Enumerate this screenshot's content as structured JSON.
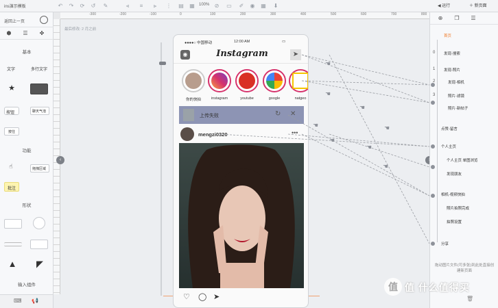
{
  "app": {
    "title": "ins演示模板",
    "zoom": "100%"
  },
  "toolbar": {
    "run_label": "运行",
    "new_page_label": "新页面"
  },
  "left_panel": {
    "back_label": "返回上一页",
    "sections": {
      "basic": "基本",
      "function": "功能",
      "shape": "形状",
      "input": "输入组件"
    },
    "widgets": {
      "text": "文字",
      "multiline_text": "多行文字",
      "link": "按钮",
      "weather": "聊天气泡",
      "small_btn": "按住",
      "function_btn": "拖拽区域",
      "annotation": "批注"
    }
  },
  "canvas": {
    "saved_label": "最后修改: 2 月之前"
  },
  "phone": {
    "status": {
      "carrier": "●●●●○ 中国移动",
      "time": "12:00 AM",
      "battery": "▭"
    },
    "app_name": "Instagram",
    "stories": [
      {
        "name": "你的快拍"
      },
      {
        "name": "instagram"
      },
      {
        "name": "youtube"
      },
      {
        "name": "google"
      },
      {
        "name": "natgeo"
      }
    ],
    "upload_text": "上传失败",
    "post_user": "mengzi0320",
    "post_more": "•••"
  },
  "right_panel": {
    "tree": [
      {
        "num": "",
        "label": "首页",
        "orange": true
      },
      {
        "num": "0",
        "label": "发现-搜索"
      },
      {
        "num": "1",
        "label": "发现-照片"
      },
      {
        "num": "2",
        "label": "发现-相机"
      },
      {
        "num": "3",
        "label": "照片-滤镜"
      },
      {
        "num": "",
        "label": "照片-新帖子"
      },
      {
        "num": "",
        "label": "点赞-留言"
      },
      {
        "num": "",
        "label": "个人主页"
      },
      {
        "num": "",
        "label": "个人主页 单图浏览"
      },
      {
        "num": "",
        "label": "发现朋友"
      },
      {
        "num": "",
        "label": "相机-视频快拍"
      },
      {
        "num": "",
        "label": "照片拍照完成"
      },
      {
        "num": "",
        "label": "拍照设置"
      },
      {
        "num": "",
        "label": "分享"
      }
    ],
    "hint": "拖动图片文件(可多张)到此处直接创建新页面"
  },
  "ruler": {
    "ticks": [
      "-300",
      "-200",
      "-100",
      "0",
      "100",
      "200",
      "300",
      "400",
      "500",
      "600",
      "700",
      "800"
    ]
  },
  "watermark": "值 什么值得买"
}
